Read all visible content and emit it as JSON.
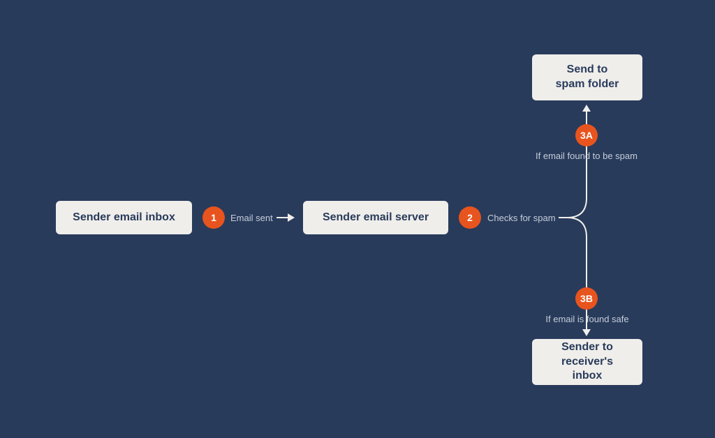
{
  "nodes": {
    "sender_inbox": "Sender email inbox",
    "sender_server": "Sender email server",
    "spam_folder": "Send to\nspam folder",
    "receiver_inbox": "Sender to\nreceiver's inbox"
  },
  "steps": {
    "s1": {
      "badge": "1",
      "label": "Email sent"
    },
    "s2": {
      "badge": "2",
      "label": "Checks for spam"
    },
    "s3a": {
      "badge": "3A",
      "label": "If email found to be spam"
    },
    "s3b": {
      "badge": "3B",
      "label": "If email is found safe"
    }
  },
  "colors": {
    "background": "#283b5b",
    "node_bg": "#f0eeeb",
    "node_text": "#283b5b",
    "badge_bg": "#e8541e",
    "line": "#f0eeeb",
    "label_text": "#c7cdd9"
  }
}
